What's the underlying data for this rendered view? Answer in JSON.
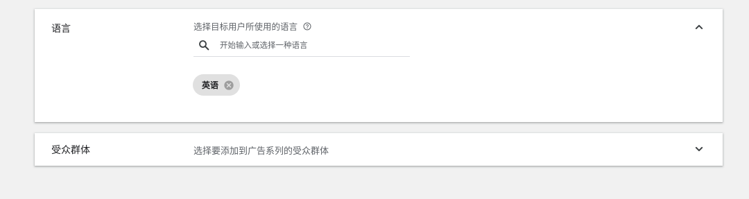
{
  "language_section": {
    "title": "语言",
    "description": "选择目标用户所使用的语言",
    "help_icon": "help-circle-icon",
    "search": {
      "placeholder": "开始输入或选择一种语言",
      "value": "",
      "icon": "search-icon"
    },
    "selected_languages": [
      {
        "label": "英语",
        "remove_icon": "cancel-circle-icon"
      }
    ],
    "expanded": true,
    "toggle_icon": "chevron-up-icon"
  },
  "audience_section": {
    "title": "受众群体",
    "description": "选择要添加到广告系列的受众群体",
    "expanded": false,
    "toggle_icon": "chevron-down-icon"
  },
  "colors": {
    "background": "#f1f1f1",
    "card": "#ffffff",
    "chip": "#e0e0e0",
    "secondary_text": "#5f6368",
    "primary_text": "#202124"
  }
}
